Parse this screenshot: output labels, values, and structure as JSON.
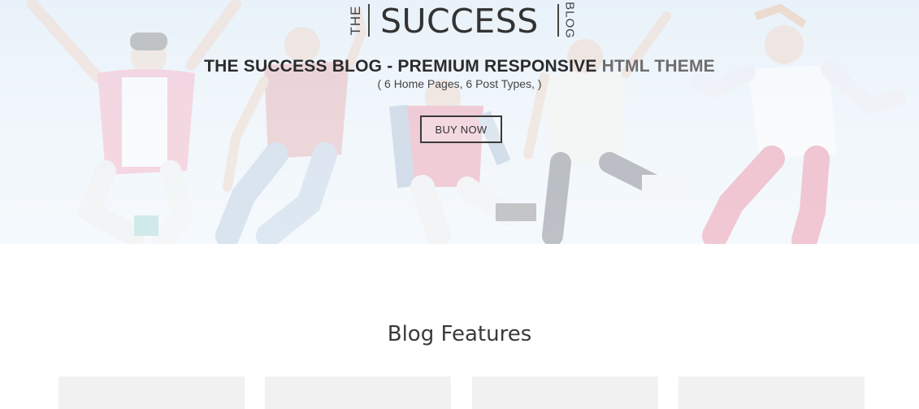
{
  "logo": {
    "prefix": "THE",
    "name": "SUCCESS",
    "suffix": "BLOG"
  },
  "hero": {
    "headline_main": "THE SUCCESS BLOG - PREMIUM RESPONSIVE ",
    "headline_accent": "HTML THEME",
    "subline": "( 6 Home Pages, 6 Post Types, )",
    "button_label": "BUY NOW"
  },
  "features": {
    "title": "Blog Features",
    "cards": [
      "",
      "",
      "",
      ""
    ]
  },
  "colors": {
    "sky": "#e3eef8",
    "text_dark": "#2b2b2b",
    "card_bg": "#f1f1f1"
  }
}
